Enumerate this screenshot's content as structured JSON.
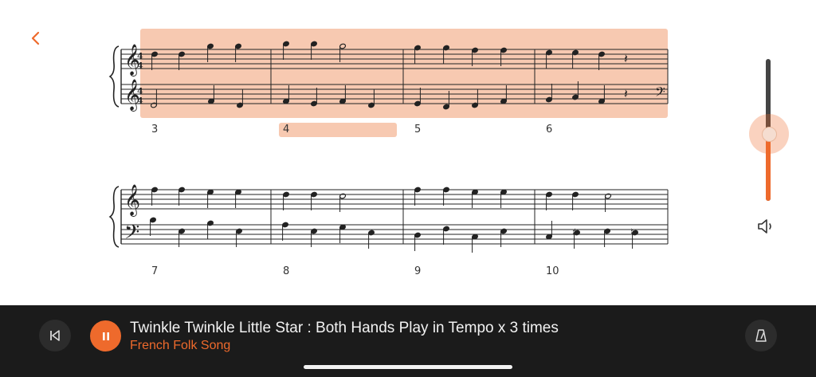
{
  "song": {
    "title": "Twinkle Twinkle Little Star : Both Hands Play in Tempo x 3 times",
    "composer": "French Folk Song"
  },
  "score": {
    "measure_numbers": [
      "3",
      "4",
      "5",
      "6",
      "7",
      "8",
      "9",
      "10"
    ],
    "current_measure": "4",
    "time_signature": "4/4"
  },
  "playback": {
    "state": "playing",
    "volume_level": 0.47
  },
  "icons": {
    "back": "chevron-left-icon",
    "previous": "skip-back-icon",
    "pause": "pause-icon",
    "metronome": "metronome-icon",
    "volume": "speaker-icon"
  },
  "colors": {
    "accent": "#ee6a2c",
    "highlight": "#f7c9b1",
    "bar": "#1b1b1b"
  }
}
